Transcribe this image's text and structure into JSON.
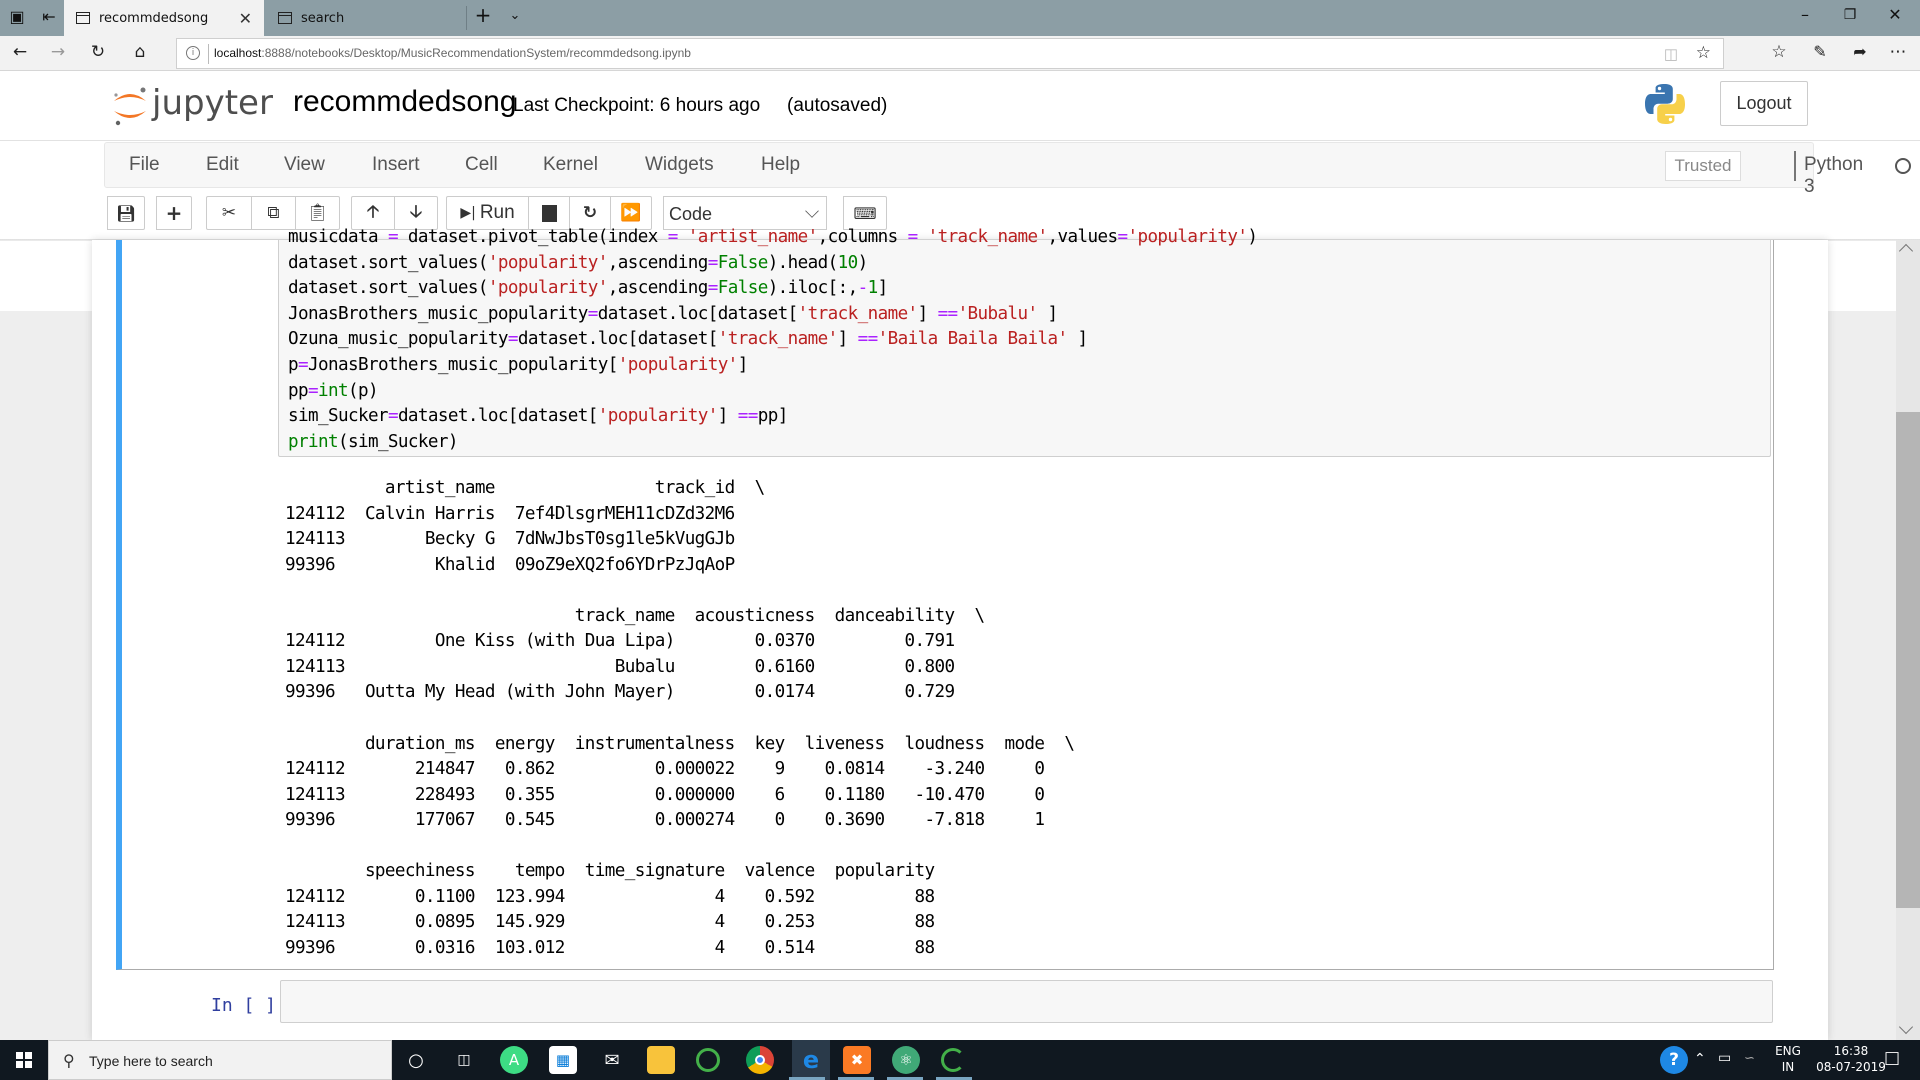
{
  "browser": {
    "tabs": [
      {
        "title": "recommdedsong",
        "active": true
      },
      {
        "title": "search",
        "active": false
      }
    ],
    "new_tab_icon": "+",
    "tab_list_icon": "chevron-down",
    "window_controls": [
      "minimize",
      "restore",
      "close"
    ],
    "url_host": "localhost",
    "url_path": ":8888/notebooks/Desktop/MusicRecommendationSystem/recommdedsong.ipynb",
    "toolbar_icons": [
      "reading-view",
      "favorite-star",
      "favorites-list",
      "pen",
      "share",
      "more"
    ]
  },
  "jupyter": {
    "logo_text": "jupyter",
    "notebook_title": "recommdedsong",
    "checkpoint": "Last Checkpoint: 6 hours ago",
    "autosave": "(autosaved)",
    "logout_label": "Logout",
    "menu": [
      "File",
      "Edit",
      "View",
      "Insert",
      "Cell",
      "Kernel",
      "Widgets",
      "Help"
    ],
    "trusted_label": "Trusted",
    "kernel_name": "Python 3",
    "toolbar": {
      "run_label": "Run",
      "cell_type": "Code"
    }
  },
  "cell": {
    "code_lines": [
      [
        {
          "t": "musicdata "
        },
        {
          "t": "=",
          "c": "o"
        },
        {
          "t": " dataset.pivot_table(index "
        },
        {
          "t": "=",
          "c": "o"
        },
        {
          "t": " "
        },
        {
          "t": "'artist_name'",
          "c": "s"
        },
        {
          "t": ",columns "
        },
        {
          "t": "=",
          "c": "o"
        },
        {
          "t": " "
        },
        {
          "t": "'track_name'",
          "c": "s"
        },
        {
          "t": ",values"
        },
        {
          "t": "=",
          "c": "o"
        },
        {
          "t": "'popularity'",
          "c": "s"
        },
        {
          "t": ")"
        }
      ],
      [
        {
          "t": "dataset.sort_values("
        },
        {
          "t": "'popularity'",
          "c": "s"
        },
        {
          "t": ",ascending"
        },
        {
          "t": "=",
          "c": "o"
        },
        {
          "t": "False",
          "c": "k"
        },
        {
          "t": ").head("
        },
        {
          "t": "10",
          "c": "k"
        },
        {
          "t": ")"
        }
      ],
      [
        {
          "t": "dataset.sort_values("
        },
        {
          "t": "'popularity'",
          "c": "s"
        },
        {
          "t": ",ascending"
        },
        {
          "t": "=",
          "c": "o"
        },
        {
          "t": "False",
          "c": "k"
        },
        {
          "t": ").iloc[:,"
        },
        {
          "t": "-",
          "c": "o"
        },
        {
          "t": "1",
          "c": "k"
        },
        {
          "t": "]"
        }
      ],
      [
        {
          "t": "JonasBrothers_music_popularity"
        },
        {
          "t": "=",
          "c": "o"
        },
        {
          "t": "dataset.loc[dataset["
        },
        {
          "t": "'track_name'",
          "c": "s"
        },
        {
          "t": "] "
        },
        {
          "t": "==",
          "c": "o"
        },
        {
          "t": "'Bubalu'",
          "c": "s"
        },
        {
          "t": " ]"
        }
      ],
      [
        {
          "t": "Ozuna_music_popularity"
        },
        {
          "t": "=",
          "c": "o"
        },
        {
          "t": "dataset.loc[dataset["
        },
        {
          "t": "'track_name'",
          "c": "s"
        },
        {
          "t": "] "
        },
        {
          "t": "==",
          "c": "o"
        },
        {
          "t": "'Baila Baila Baila'",
          "c": "s"
        },
        {
          "t": " ]"
        }
      ],
      [
        {
          "t": "p"
        },
        {
          "t": "=",
          "c": "o"
        },
        {
          "t": "JonasBrothers_music_popularity["
        },
        {
          "t": "'popularity'",
          "c": "s"
        },
        {
          "t": "]"
        }
      ],
      [
        {
          "t": "pp"
        },
        {
          "t": "=",
          "c": "o"
        },
        {
          "t": "int",
          "c": "k"
        },
        {
          "t": "(p)"
        }
      ],
      [
        {
          "t": "sim_Sucker"
        },
        {
          "t": "=",
          "c": "o"
        },
        {
          "t": "dataset.loc[dataset["
        },
        {
          "t": "'popularity'",
          "c": "s"
        },
        {
          "t": "] "
        },
        {
          "t": "==",
          "c": "o"
        },
        {
          "t": "pp]"
        }
      ],
      [
        {
          "t": "print",
          "c": "k"
        },
        {
          "t": "(sim_Sucker)"
        }
      ]
    ],
    "output_lines": [
      "          artist_name                track_id  \\",
      "124112  Calvin Harris  7ef4DlsgrMEH11cDZd32M6   ",
      "124113        Becky G  7dNwJbsT0sg1le5kVugGJb   ",
      "99396          Khalid  09oZ9eXQ2fo6YDrPzJqAoP   ",
      "",
      "                             track_name  acousticness  danceability  \\",
      "124112         One Kiss (with Dua Lipa)        0.0370         0.791   ",
      "124113                           Bubalu        0.6160         0.800   ",
      "99396   Outta My Head (with John Mayer)        0.0174         0.729   ",
      "",
      "        duration_ms  energy  instrumentalness  key  liveness  loudness  mode  \\",
      "124112       214847   0.862          0.000022    9    0.0814    -3.240     0   ",
      "124113       228493   0.355          0.000000    6    0.1180   -10.470     0   ",
      "99396        177067   0.545          0.000274    0    0.3690    -7.818     1   ",
      "",
      "        speechiness    tempo  time_signature  valence  popularity  ",
      "124112       0.1100  123.994               4    0.592          88  ",
      "124113       0.0895  145.929               4    0.253          88  ",
      "99396        0.0316  103.012               4    0.514          88  "
    ],
    "next_prompt": "In [ ]:"
  },
  "taskbar": {
    "search_placeholder": "Type here to search",
    "apps": [
      "cortana",
      "task-view",
      "android-studio",
      "store",
      "mail",
      "file-explorer",
      "anaconda",
      "chrome",
      "edge",
      "xampp",
      "atom",
      "jupyter"
    ],
    "lang_top": "ENG",
    "lang_bottom": "IN",
    "time": "16:38",
    "date": "08-07-2019"
  }
}
